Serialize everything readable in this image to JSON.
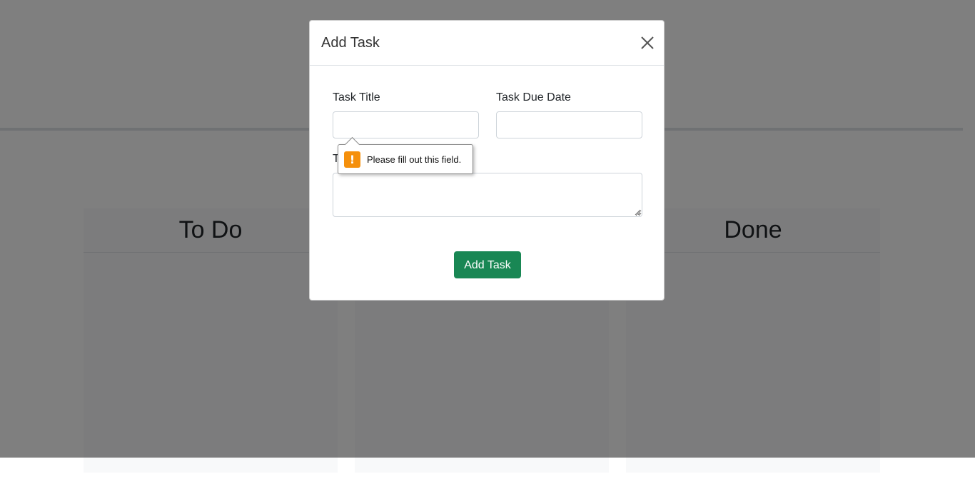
{
  "board": {
    "columns": [
      {
        "title": "To Do"
      },
      {
        "title": ""
      },
      {
        "title": "Done"
      }
    ]
  },
  "modal": {
    "title": "Add Task",
    "close_icon": "close-icon",
    "fields": {
      "title_label": "Task Title",
      "title_value": "",
      "due_date_label": "Task Due Date",
      "due_date_value": "",
      "description_label": "T",
      "description_value": ""
    },
    "submit_label": "Add Task",
    "submit_color": "#198754"
  },
  "validation": {
    "icon": "warning-icon",
    "icon_glyph": "!",
    "icon_color": "#f5900c",
    "message": "Please fill out this field."
  }
}
